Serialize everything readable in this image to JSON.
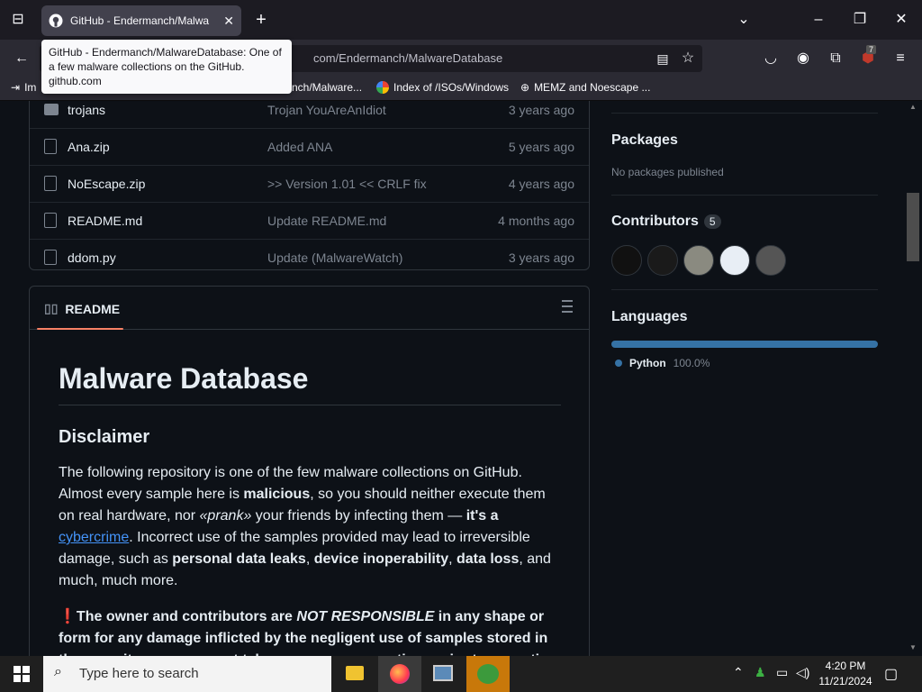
{
  "browser": {
    "tab_title": "GitHub - Endermanch/Malwa",
    "url_visible": "com/Endermanch/MalwareDatabase",
    "tooltip_title": "GitHub - Endermanch/MalwareDatabase: One of a few malware collections on the GitHub.",
    "tooltip_host": "github.com",
    "extension_badge": "7",
    "bookmarks": [
      {
        "label": "Im"
      },
      {
        "label": "nch/Malware..."
      },
      {
        "label": "Index of /ISOs/Windows"
      },
      {
        "label": "MEMZ and Noescape ..."
      }
    ]
  },
  "files": [
    {
      "name": "trojans",
      "message": "Trojan YouAreAnIdiot",
      "age": "3 years ago",
      "type": "folder"
    },
    {
      "name": "Ana.zip",
      "message": "Added ANA",
      "age": "5 years ago",
      "type": "file"
    },
    {
      "name": "NoEscape.zip",
      "message": ">> Version 1.01 << CRLF fix",
      "age": "4 years ago",
      "type": "file"
    },
    {
      "name": "README.md",
      "message": "Update README.md",
      "age": "4 months ago",
      "type": "file"
    },
    {
      "name": "ddom.py",
      "message": "Update (MalwareWatch)",
      "age": "3 years ago",
      "type": "file"
    }
  ],
  "readme": {
    "tab_label": "README",
    "h1": "Malware Database",
    "h2": "Disclaimer",
    "p1_a": "The following repository is one of the few malware collections on GitHub. Almost every sample here is ",
    "p1_b": "malicious",
    "p1_c": ", so you should neither execute them on real hardware, nor ",
    "p1_d": "«prank»",
    "p1_e": " your friends by infecting them — ",
    "p1_f": "it's a ",
    "p1_link": "cybercrime",
    "p1_g": ". Incorrect use of the samples provided may lead to irreversible damage, such as ",
    "p1_h": "personal data leaks",
    "p1_i": ", ",
    "p1_j": "device inoperability",
    "p1_k": ", ",
    "p1_l": "data loss",
    "p1_m": ", and much, much more.",
    "p2_mark": "❗",
    "p2_a": "The owner and contributors are ",
    "p2_b": "NOT RESPONSIBLE",
    "p2_c": " in any shape or form for any damage inflicted by the negligent use of samples stored in the repository, users must take necessary precautions prior to executing the"
  },
  "sidebar": {
    "packages_title": "Packages",
    "packages_text": "No packages published",
    "contributors_title": "Contributors",
    "contributors_count": "5",
    "languages_title": "Languages",
    "language_name": "Python",
    "language_pct": "100.0%"
  },
  "taskbar": {
    "search_placeholder": "Type here to search",
    "time": "4:20 PM",
    "date": "11/21/2024"
  },
  "colors": {
    "link": "#4493f8",
    "python": "#3572a5",
    "accent_underline": "#f78166"
  }
}
